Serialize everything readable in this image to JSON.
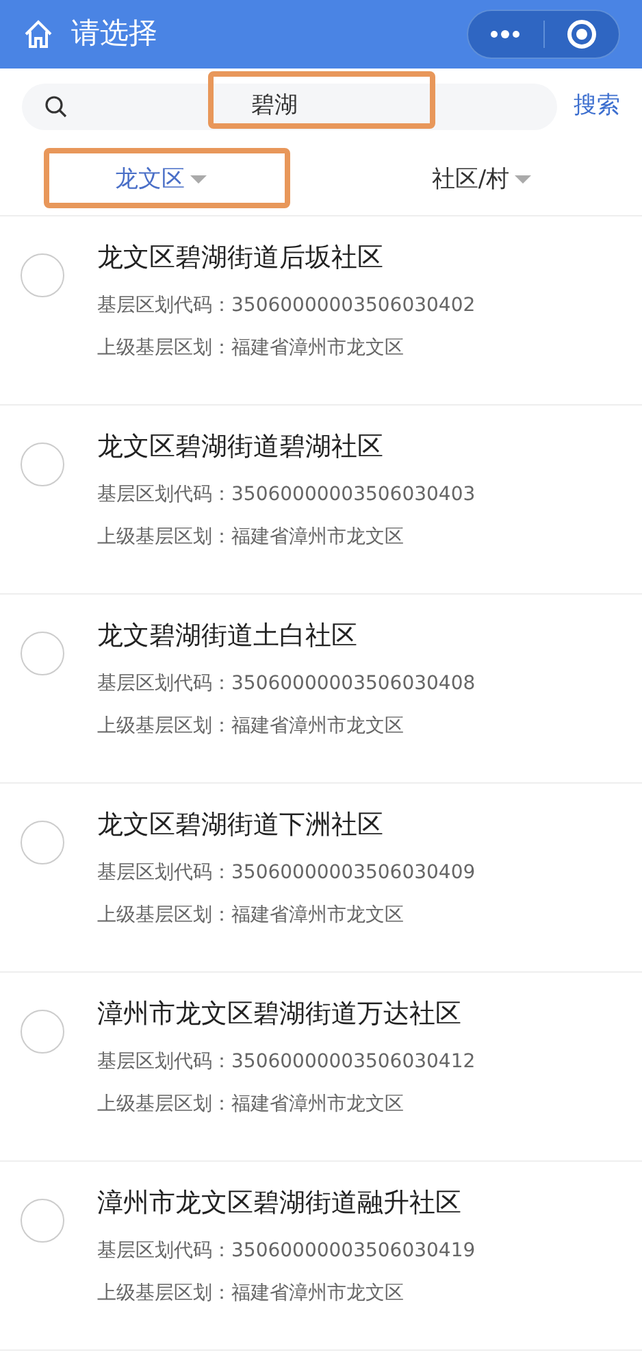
{
  "header": {
    "title": "请选择"
  },
  "search": {
    "value": "碧湖",
    "button": "搜索",
    "highlighted": true
  },
  "filters": [
    {
      "label": "龙文区",
      "selected": true,
      "highlighted": true
    },
    {
      "label": "社区/村",
      "selected": false,
      "highlighted": false
    }
  ],
  "items": [
    {
      "name": "龙文区碧湖街道后坂社区",
      "code": "基层区划代码：35060000003506030402",
      "parent": "上级基层区划：福建省漳州市龙文区",
      "selected": false
    },
    {
      "name": "龙文区碧湖街道碧湖社区",
      "code": "基层区划代码：35060000003506030403",
      "parent": "上级基层区划：福建省漳州市龙文区",
      "selected": false
    },
    {
      "name": "龙文碧湖街道土白社区",
      "code": "基层区划代码：35060000003506030408",
      "parent": "上级基层区划：福建省漳州市龙文区",
      "selected": false
    },
    {
      "name": "龙文区碧湖街道下洲社区",
      "code": "基层区划代码：35060000003506030409",
      "parent": "上级基层区划：福建省漳州市龙文区",
      "selected": false
    },
    {
      "name": "漳州市龙文区碧湖街道万达社区",
      "code": "基层区划代码：35060000003506030412",
      "parent": "上级基层区划：福建省漳州市龙文区",
      "selected": false
    },
    {
      "name": "漳州市龙文区碧湖街道融升社区",
      "code": "基层区划代码：35060000003506030419",
      "parent": "上级基层区划：福建省漳州市龙文区",
      "selected": false
    }
  ]
}
